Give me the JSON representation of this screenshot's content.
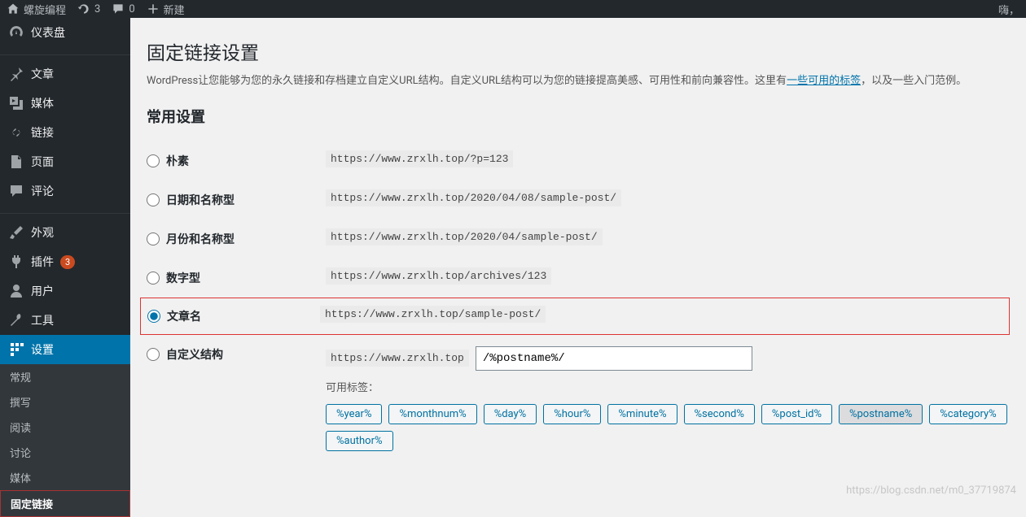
{
  "adminbar": {
    "site_name": "螺旋编程",
    "updates": "3",
    "comments": "0",
    "new": "新建",
    "greeting": "嗨，"
  },
  "sidebar": {
    "items": [
      {
        "label": "仪表盘"
      },
      {
        "label": "文章"
      },
      {
        "label": "媒体"
      },
      {
        "label": "链接"
      },
      {
        "label": "页面"
      },
      {
        "label": "评论"
      },
      {
        "label": "外观"
      },
      {
        "label": "插件",
        "badge": "3"
      },
      {
        "label": "用户"
      },
      {
        "label": "工具"
      },
      {
        "label": "设置"
      }
    ],
    "submenu": [
      {
        "label": "常规"
      },
      {
        "label": "撰写"
      },
      {
        "label": "阅读"
      },
      {
        "label": "讨论"
      },
      {
        "label": "媒体"
      },
      {
        "label": "固定链接"
      }
    ]
  },
  "page": {
    "title": "固定链接设置",
    "desc_prefix": "WordPress让您能够为您的永久链接和存档建立自定义URL结构。自定义URL结构可以为您的链接提高美感、可用性和前向兼容性。这里有",
    "desc_link": "一些可用的标签",
    "desc_suffix": "，以及一些入门范例。",
    "common_heading": "常用设置",
    "options": [
      {
        "label": "朴素",
        "url": "https://www.zrxlh.top/?p=123",
        "checked": false
      },
      {
        "label": "日期和名称型",
        "url": "https://www.zrxlh.top/2020/04/08/sample-post/",
        "checked": false
      },
      {
        "label": "月份和名称型",
        "url": "https://www.zrxlh.top/2020/04/sample-post/",
        "checked": false
      },
      {
        "label": "数字型",
        "url": "https://www.zrxlh.top/archives/123",
        "checked": false
      },
      {
        "label": "文章名",
        "url": "https://www.zrxlh.top/sample-post/",
        "checked": true
      }
    ],
    "custom": {
      "label": "自定义结构",
      "prefix": "https://www.zrxlh.top",
      "value": "/%postname%/",
      "available_label": "可用标签：",
      "tags": [
        "%year%",
        "%monthnum%",
        "%day%",
        "%hour%",
        "%minute%",
        "%second%",
        "%post_id%",
        "%postname%",
        "%category%",
        "%author%"
      ],
      "active_tag": "%postname%"
    }
  },
  "watermark": "https://blog.csdn.net/m0_37719874"
}
